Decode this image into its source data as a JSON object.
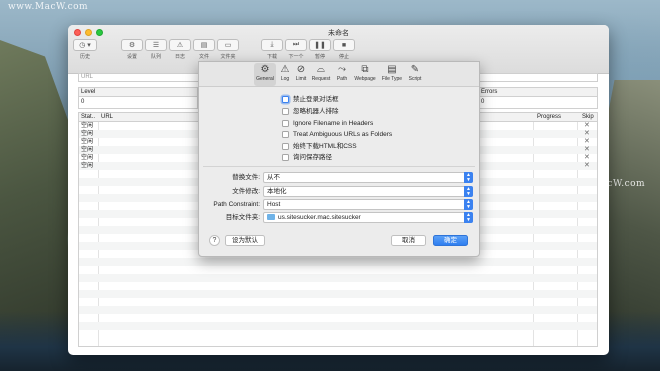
{
  "watermark": "www.MacW.com",
  "window": {
    "title": "未命名",
    "toolbar": {
      "history_label": "历史",
      "settings_label": "设置",
      "queue_label": "队列",
      "log_label": "日志",
      "file_label": "文件",
      "folder_label": "文件夹",
      "download_label": "下载",
      "next_label": "下一个",
      "pause_label": "暂停",
      "stop_label": "停止"
    },
    "url_placeholder": "URL",
    "level": {
      "header": "Level",
      "value": "0"
    },
    "errors": {
      "header": "Errors",
      "value": "0"
    },
    "table": {
      "columns": {
        "status": "Stat..",
        "url": "URL",
        "progress": "Progress",
        "skip": "Skip"
      },
      "rows": [
        {
          "status": "空闲",
          "skip": "✕"
        },
        {
          "status": "空闲",
          "skip": "✕"
        },
        {
          "status": "空闲",
          "skip": "✕"
        },
        {
          "status": "空闲",
          "skip": "✕"
        },
        {
          "status": "空闲",
          "skip": "✕"
        },
        {
          "status": "空闲",
          "skip": "✕"
        }
      ]
    }
  },
  "sheet": {
    "tabs": [
      {
        "label": "General",
        "icon": "gear-icon"
      },
      {
        "label": "Log",
        "icon": "warning-icon"
      },
      {
        "label": "Limit",
        "icon": "limit-icon"
      },
      {
        "label": "Request",
        "icon": "request-icon"
      },
      {
        "label": "Path",
        "icon": "path-icon"
      },
      {
        "label": "Webpage",
        "icon": "webpage-icon"
      },
      {
        "label": "File Type",
        "icon": "file-type-icon"
      },
      {
        "label": "Script",
        "icon": "script-icon"
      }
    ],
    "checkboxes": [
      {
        "label": "禁止登录对话框",
        "checked": false
      },
      {
        "label": "忽略机器人排除",
        "checked": false
      },
      {
        "label": "Ignore Filename in Headers",
        "checked": false
      },
      {
        "label": "Treat Ambiguous URLs as Folders",
        "checked": false
      },
      {
        "label": "始终下载HTML和CSS",
        "checked": false
      },
      {
        "label": "询问保存路径",
        "checked": false
      }
    ],
    "fields": {
      "replace_files": {
        "label": "替换文件:",
        "value": "从不"
      },
      "file_modification": {
        "label": "文件修改:",
        "value": "本地化"
      },
      "path_constraint": {
        "label": "Path Constraint:",
        "value": "Host"
      },
      "destination": {
        "label": "目标文件夹:",
        "value": "us.sitesucker.mac.sitesucker"
      }
    },
    "buttons": {
      "help": "?",
      "set_default": "设为默认",
      "cancel": "取消",
      "ok": "确定"
    }
  }
}
